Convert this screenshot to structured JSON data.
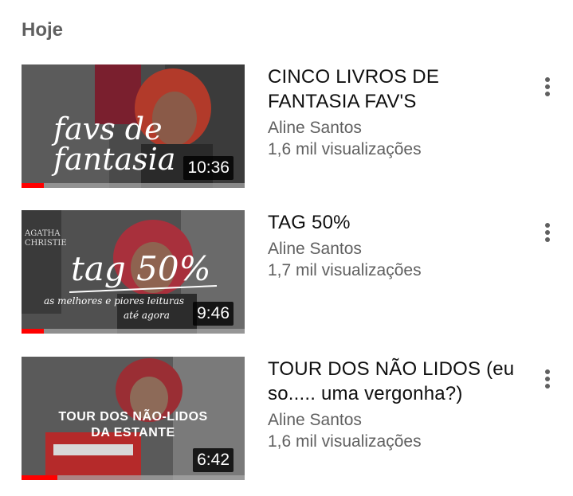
{
  "section": {
    "title": "Hoje"
  },
  "videos": [
    {
      "title": "CINCO LIVROS DE FANTASIA FAV'S",
      "channel": "Aline Santos",
      "views": "1,6 mil visualizações",
      "duration": "10:36",
      "watched_fraction": 0.1,
      "thumb_text": "favs de fantasia"
    },
    {
      "title": "TAG 50%",
      "channel": "Aline Santos",
      "views": "1,7 mil visualizações",
      "duration": "9:46",
      "watched_fraction": 0.1,
      "thumb_text": "tag 50%",
      "thumb_subtext_1": "as melhores e piores leituras",
      "thumb_subtext_2": "até agora",
      "thumb_book_label": "AGATHA CHRISTIE"
    },
    {
      "title": "TOUR DOS NÃO LIDOS (eu so..... uma vergonha?)",
      "channel": "Aline Santos",
      "views": "1,6 mil visualizações",
      "duration": "6:42",
      "watched_fraction": 0.16,
      "thumb_text_1": "TOUR DOS NÃO-LIDOS",
      "thumb_text_2": "DA ESTANTE"
    }
  ],
  "colors": {
    "progress": "#ff0000",
    "secondary_text": "#606060"
  }
}
